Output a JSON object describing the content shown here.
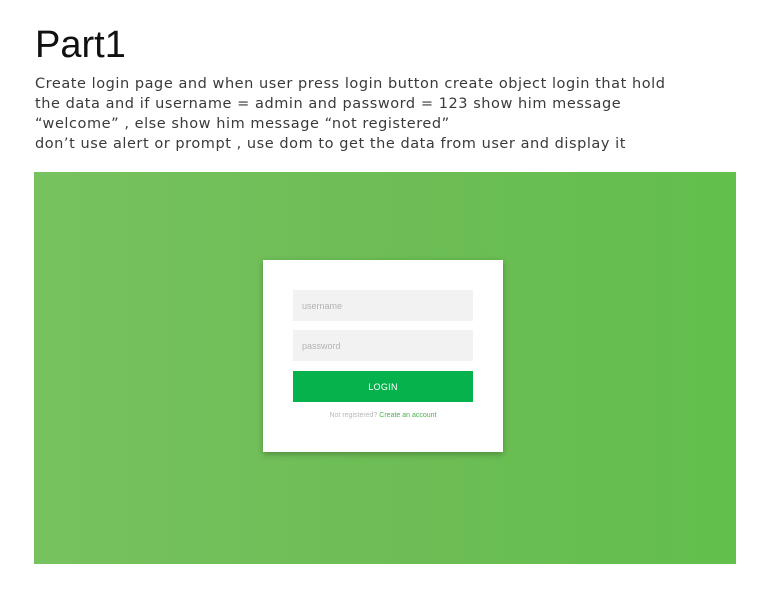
{
  "slide": {
    "title": "Part1",
    "instructions": [
      "Create login page and when user press login button create object login that hold",
      "the data and if username = admin and password = 123 show him message",
      "“welcome” , else show him message “not registered”",
      "don’t use alert or prompt , use dom to get the data from user and display it"
    ]
  },
  "login_form": {
    "username_placeholder": "username",
    "username_value": "",
    "password_placeholder": "password",
    "password_value": "",
    "login_label": "LOGIN",
    "register_prompt": "Not registered?",
    "register_link_label": "Create an account"
  },
  "colors": {
    "background_gradient_start": "#76c25f",
    "background_gradient_end": "#62bf4c",
    "login_button": "#06b24c",
    "link": "#47b34a",
    "input_background": "#f2f2f2"
  }
}
